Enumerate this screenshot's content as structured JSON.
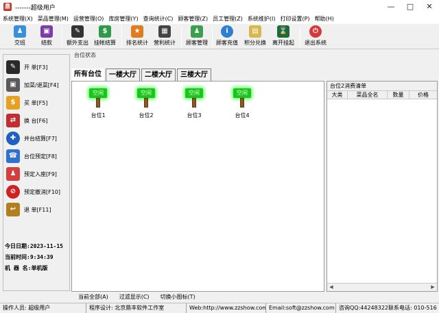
{
  "window": {
    "title": "-------超级用户"
  },
  "menu": [
    "系统管理(X)",
    "菜品管理(M)",
    "运营管理(O)",
    "库房管理(Y)",
    "查询统计(C)",
    "顾客管理(Z)",
    "员工管理(Z)",
    "系统维护(I)",
    "打印设置(P)",
    "帮助(H)"
  ],
  "toolbar": [
    "交班",
    "结款",
    "额外支出",
    "挂帐结算",
    "排名统计",
    "营利统计",
    "顾客管理",
    "顾客充值",
    "积分兑换",
    "离开挂起",
    "退出系统"
  ],
  "status_title": "台位状态",
  "sidebar": {
    "items": [
      "开    单[F3]",
      "加菜/退菜[F4]",
      "买    单[F5]",
      "换    台[F6]",
      "并台结算[F7]",
      "台位预定[F8]",
      "预定入座[F9]",
      "预定撤消[F10]",
      "退    单[F11]"
    ],
    "date_line": "今日日期:2023-11-15",
    "time_line": "当前时间:9:34:39",
    "machine_line": "机 器 名:单机版"
  },
  "tabs": [
    "所有台位",
    "一楼大厅",
    "二楼大厅",
    "三楼大厅"
  ],
  "tables": [
    {
      "status": "空闲",
      "name": "台位1"
    },
    {
      "status": "空闲",
      "name": "台位2"
    },
    {
      "status": "空闲",
      "name": "台位3"
    },
    {
      "status": "空闲",
      "name": "台位4"
    }
  ],
  "bill": {
    "title": "台位2消费清单",
    "columns": [
      "大类",
      "菜品全名",
      "数量",
      "价格"
    ]
  },
  "bottom_options": [
    "当前全部(A)",
    "过滤显示(C)",
    "切换小图标(T)"
  ],
  "statusbar": {
    "operator": "操作人员: 超级用户",
    "designer": "程序设计: 北京鼎丰软件工作室",
    "web": "Web:http://www.zzshow.com",
    "email": "Email:soft@zzshow.com",
    "contact": "咨询QQ:44248322联系电话: 010-516"
  }
}
